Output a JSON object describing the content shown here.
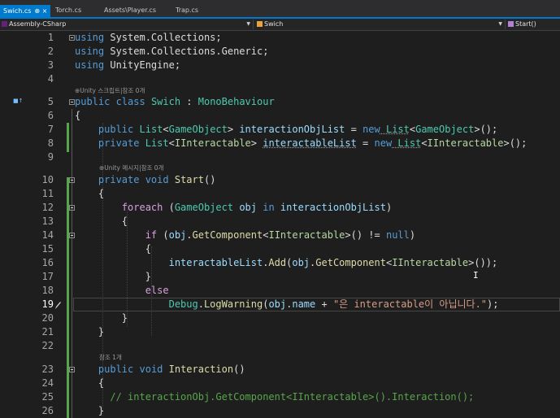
{
  "tabs": [
    {
      "label": "Swich.cs",
      "active": true
    },
    {
      "label": "Torch.cs",
      "active": false
    },
    {
      "label": "Assets\\Player.cs",
      "active": false
    },
    {
      "label": "Trap.cs",
      "active": false
    }
  ],
  "tab_close_glyphs": "⊕ ×",
  "nav": {
    "project": "Assembly-CSharp",
    "class": "Swich",
    "member": "Start()"
  },
  "hints": {
    "class": "⊕Unity 스크립트|참조 0개",
    "start": "⊕Unity 메시지|참조 0개",
    "interaction": "참조 1개"
  },
  "line_numbers": [
    "1",
    "2",
    "3",
    "4",
    "5",
    "6",
    "7",
    "8",
    "9",
    "10",
    "11",
    "12",
    "13",
    "14",
    "15",
    "16",
    "17",
    "18",
    "19",
    "20",
    "21",
    "22",
    "23",
    "24",
    "25",
    "26"
  ],
  "current_line": "19",
  "code": {
    "l1_kw": "using",
    "l1_ns": " System.Collections;",
    "l2_kw": "using",
    "l2_ns": " System.Collections.Generic;",
    "l3_kw": "using",
    "l3_ns": " UnityEngine;",
    "l5_kw1": "public",
    "l5_kw2": " class ",
    "l5_name": "Swich",
    "l5_colon": " : ",
    "l5_base": "MonoBehaviour",
    "l6": "{",
    "l7_kw": "public",
    "l7_list": " List",
    "l7_lt": "<",
    "l7_t": "GameObject",
    "l7_gt": "> ",
    "l7_var": "interactionObjList",
    "l7_eq": " = ",
    "l7_new": "new",
    "l7_list2": " List",
    "l7_lt2": "<",
    "l7_t2": "GameObject",
    "l7_end": ">();",
    "l8_kw": "private",
    "l8_list": " List",
    "l8_lt": "<",
    "l8_t": "IInteractable",
    "l8_gt": "> ",
    "l8_var": "interactableList",
    "l8_eq": " = ",
    "l8_new": "new",
    "l8_list2": " List",
    "l8_lt2": "<",
    "l8_t2": "IInteractable",
    "l8_end": ">();",
    "l10_kw1": "private",
    "l10_kw2": " void ",
    "l10_fn": "Start",
    "l10_end": "()",
    "l11": "{",
    "l12_kw": "foreach",
    "l12_p": " (",
    "l12_t": "GameObject",
    "l12_sp": " ",
    "l12_v": "obj",
    "l12_in": " in ",
    "l12_list": "interactionObjList",
    "l12_end": ")",
    "l13": "{",
    "l14_kw": "if",
    "l14_p": " (",
    "l14_v": "obj",
    "l14_dot": ".",
    "l14_fn": "GetComponent",
    "l14_lt": "<",
    "l14_t": "IInteractable",
    "l14_gt": ">() != ",
    "l14_null": "null",
    "l14_end": ")",
    "l15": "{",
    "l16_v": "interactableList",
    "l16_dot": ".",
    "l16_fn": "Add",
    "l16_p": "(",
    "l16_v2": "obj",
    "l16_dot2": ".",
    "l16_fn2": "GetComponent",
    "l16_lt": "<",
    "l16_t": "IInteractable",
    "l16_end": ">());",
    "l17": "}",
    "l18": "else",
    "l19_t": "Debug",
    "l19_dot": ".",
    "l19_fn": "LogWarning",
    "l19_p": "(",
    "l19_v": "obj",
    "l19_dot2": ".",
    "l19_prop": "name",
    "l19_plus": " + ",
    "l19_str": "\"은 interactable이 아닙니다.\"",
    "l19_end": ");",
    "l20": "}",
    "l21": "}",
    "l23_kw1": "public",
    "l23_kw2": " void ",
    "l23_fn": "Interaction",
    "l23_end": "()",
    "l24": "{",
    "l25": "// interactionObj.GetComponent<IInteractable>().Interaction();",
    "l26": "}"
  },
  "cursor_glyph": "I",
  "gutter_marker": "■↑"
}
